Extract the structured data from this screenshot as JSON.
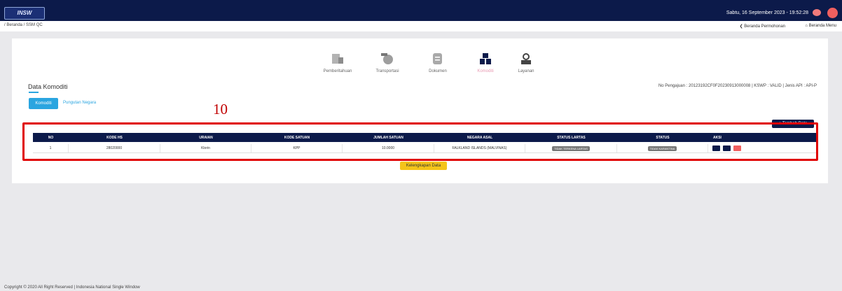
{
  "header": {
    "datetime": "Sabtu, 16 September 2023 - 19:52:28",
    "logo_text": "INSW"
  },
  "breadcrumb": {
    "path": "/ Beranda / SSM QC",
    "link_permohonan": "❮ Beranda Permohonan",
    "link_menu": "⌂ Beranda Menu"
  },
  "steps": [
    {
      "label": "Pemberitahuan",
      "icon": "building-icon",
      "active": false
    },
    {
      "label": "Transportasi",
      "icon": "globe-transport-icon",
      "active": false
    },
    {
      "label": "Dokumen",
      "icon": "document-icon",
      "active": false
    },
    {
      "label": "Komoditi",
      "icon": "boxes-icon",
      "active": true
    },
    {
      "label": "Layanan",
      "icon": "service-icon",
      "active": false
    }
  ],
  "section": {
    "title": "Data Komoditi",
    "pengajuan": "No Pengajuan : 20123192CF0F20230913000008 | KSWP : VALID | Jenis API : API-P",
    "tab_komoditi": "Komoditi",
    "tab_pungutan": "Pungutan Negara",
    "tambah_label": "+ Tambah Data"
  },
  "annotation": {
    "number": "10"
  },
  "table": {
    "headers": [
      "NO",
      "KODE HS",
      "URAIAN",
      "KODE SATUAN",
      "JUMLAH SATUAN",
      "NEGARA ASAL",
      "STATUS LARTAS",
      "STATUS",
      "AKSI"
    ],
    "rows": [
      {
        "no": "1",
        "kode_hs": "28020000",
        "uraian": "Klorin",
        "kode_satuan": "KPP",
        "jumlah_satuan": "10.0000",
        "negara_asal": "FALKLAND ISLANDS (MALVINAS)",
        "status_lartas": "TIDAK TERKENA LARTAS",
        "status": "TIDAK KARANTINA"
      }
    ]
  },
  "buttons": {
    "kelengkapan": "Kelengkapan Data"
  },
  "footer": {
    "text": "Copyright © 2020 All Right Reserved | Indonesia National Single Window"
  },
  "colors": {
    "navy": "#0c1a4a",
    "accent_blue": "#2aa5e0",
    "yellow": "#f4c41a",
    "annotation_red": "#e00000"
  }
}
